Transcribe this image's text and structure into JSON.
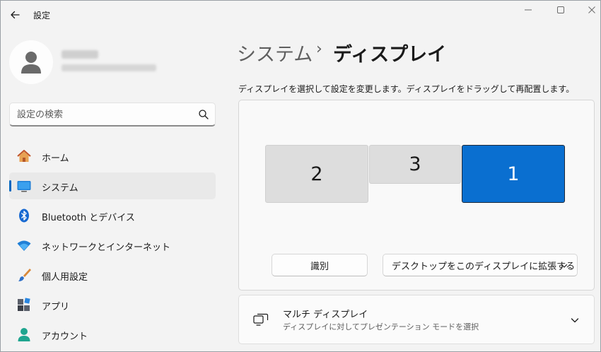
{
  "window": {
    "title": "設定"
  },
  "user": {
    "avatar_icon": "person-icon"
  },
  "search": {
    "placeholder": "設定の検索"
  },
  "sidebar": {
    "items": [
      {
        "label": "ホーム",
        "icon": "home-icon"
      },
      {
        "label": "システム",
        "icon": "system-icon",
        "selected": true
      },
      {
        "label": "Bluetooth とデバイス",
        "icon": "bluetooth-icon"
      },
      {
        "label": "ネットワークとインターネット",
        "icon": "wifi-icon"
      },
      {
        "label": "個人用設定",
        "icon": "brush-icon"
      },
      {
        "label": "アプリ",
        "icon": "apps-icon"
      },
      {
        "label": "アカウント",
        "icon": "account-icon"
      }
    ]
  },
  "breadcrumb": {
    "parent": "システム",
    "separator": "›",
    "current": "ディスプレイ"
  },
  "main": {
    "description": "ディスプレイを選択して設定を変更します。ディスプレイをドラッグして再配置します。",
    "monitors": [
      {
        "label": "2",
        "selected": false
      },
      {
        "label": "3",
        "selected": false
      },
      {
        "label": "1",
        "selected": true
      }
    ],
    "identify_button": "識別",
    "extend_select": "デスクトップをこのディスプレイに拡張する",
    "multi_display": {
      "title": "マルチ ディスプレイ",
      "subtitle": "ディスプレイに対してプレゼンテーション モードを選択"
    }
  },
  "colors": {
    "accent": "#0067c0",
    "selected_monitor": "#0a6fd0",
    "monitor": "#dddddd"
  }
}
